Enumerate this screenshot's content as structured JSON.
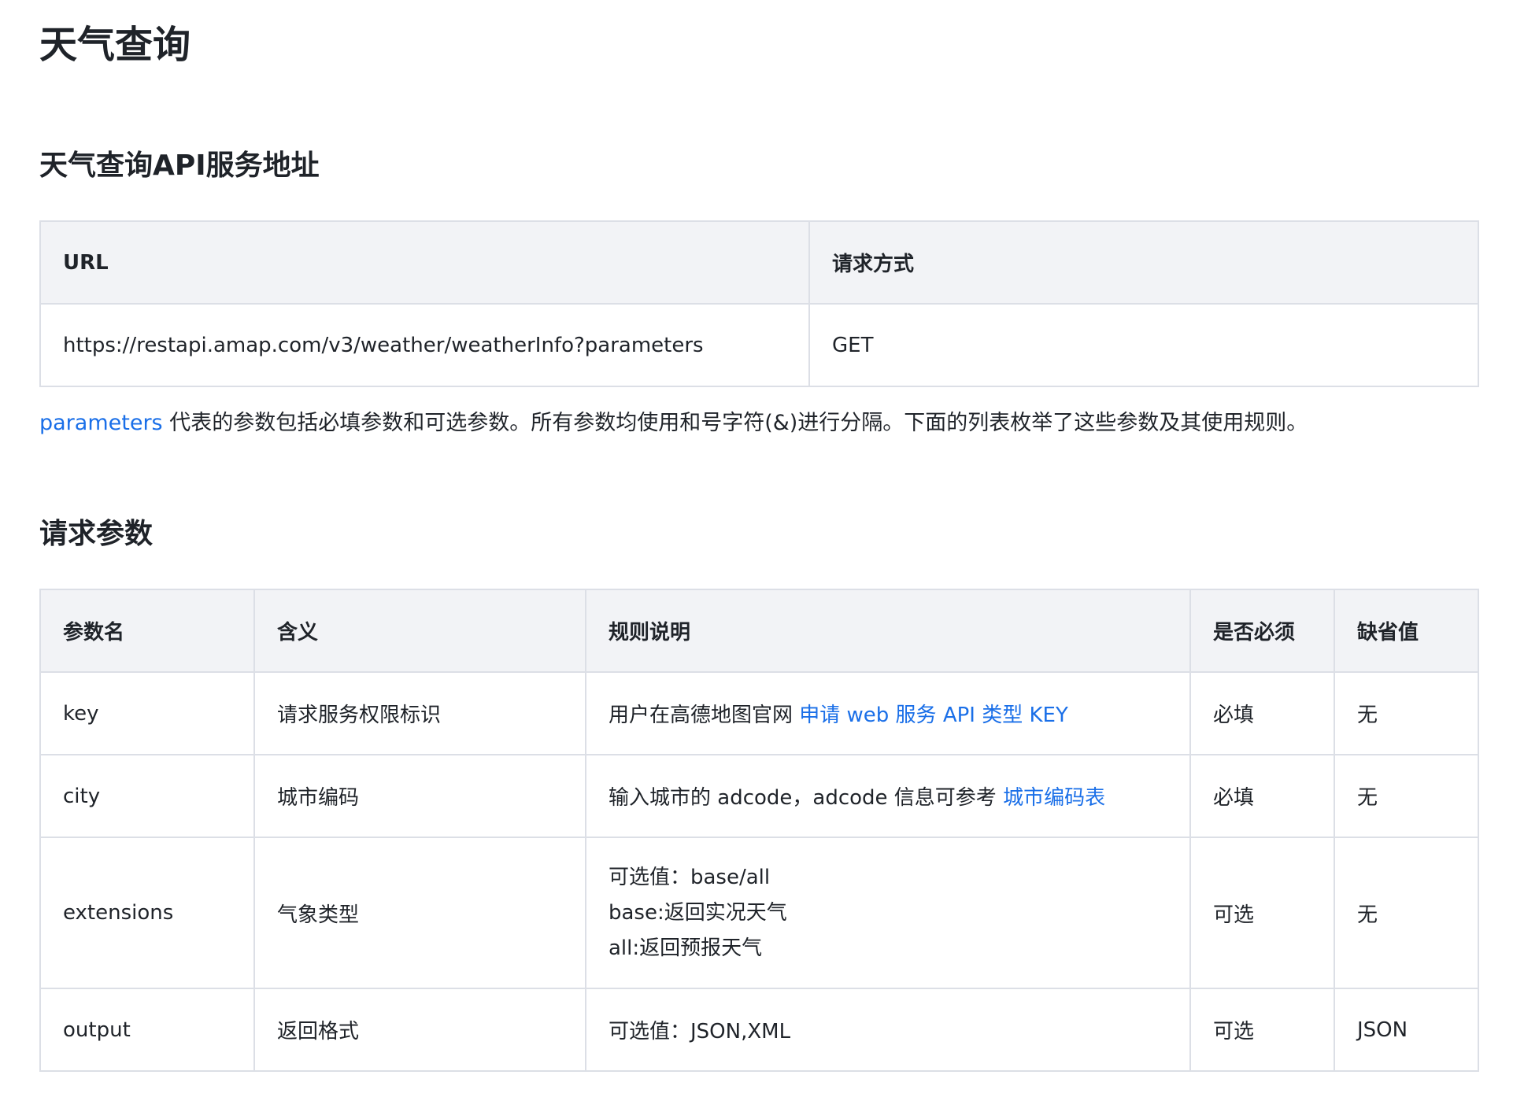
{
  "page_title": "天气查询",
  "url_section": {
    "heading": "天气查询API服务地址",
    "headers": [
      "URL",
      "请求方式"
    ],
    "row": [
      "https://restapi.amap.com/v3/weather/weatherInfo?parameters",
      "GET"
    ]
  },
  "description": {
    "link_text": "parameters",
    "text": " 代表的参数包括必填参数和可选参数。所有参数均使用和号字符(&)进行分隔。下面的列表枚举了这些参数及其使用规则。"
  },
  "params_section": {
    "heading": "请求参数",
    "headers": [
      "参数名",
      "含义",
      "规则说明",
      "是否必须",
      "缺省值"
    ],
    "rows": [
      {
        "name": "key",
        "meaning": "请求服务权限标识",
        "rule_text": "用户在高德地图官网 ",
        "rule_link": "申请 web 服务 API 类型 KEY",
        "required": "必填",
        "default": "无"
      },
      {
        "name": "city",
        "meaning": "城市编码",
        "rule_text": "输入城市的 adcode，adcode 信息可参考 ",
        "rule_link": "城市编码表",
        "required": "必填",
        "default": "无"
      },
      {
        "name": "extensions",
        "meaning": "气象类型",
        "rule_lines": [
          "可选值：base/all",
          "base:返回实况天气",
          "all:返回预报天气"
        ],
        "required": "可选",
        "default": "无"
      },
      {
        "name": "output",
        "meaning": "返回格式",
        "rule_text": "可选值：JSON,XML",
        "required": "可选",
        "default": "JSON"
      }
    ]
  },
  "colors": {
    "link": "#1a6fe8",
    "header_bg": "#f2f3f6",
    "border": "#dcdfe6",
    "text": "#1f2329"
  }
}
